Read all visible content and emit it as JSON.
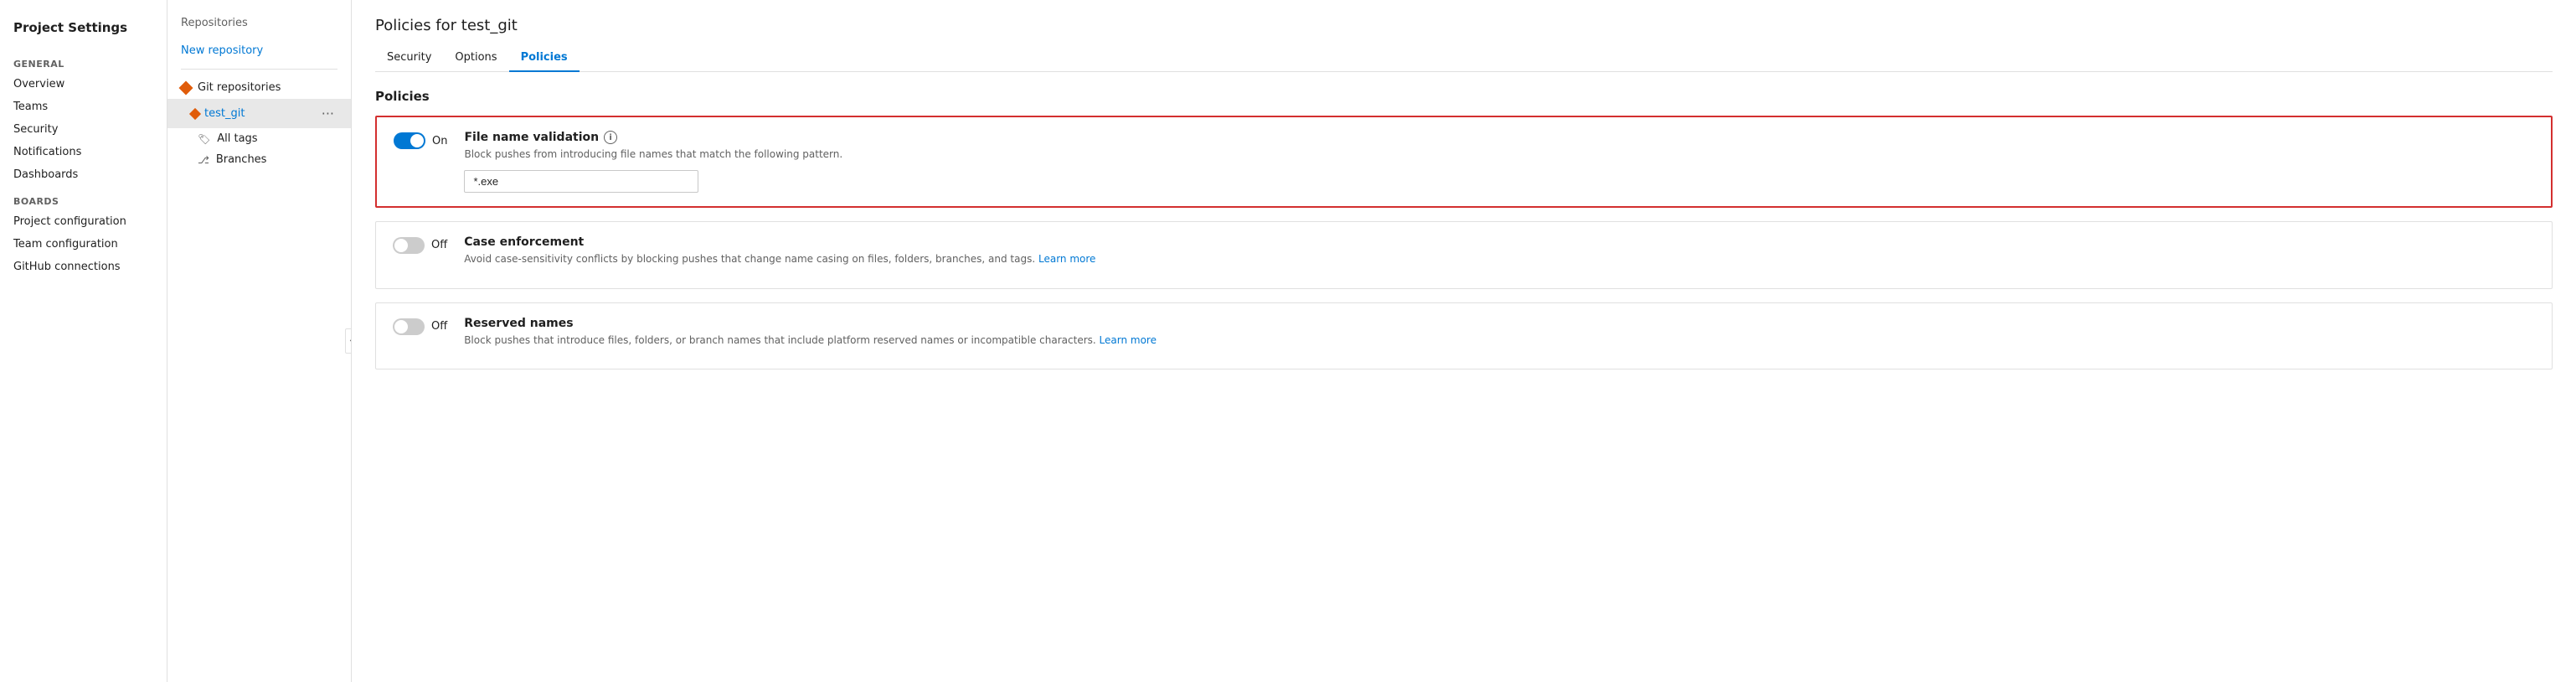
{
  "sidebar": {
    "title": "Project Settings",
    "general_label": "General",
    "items": [
      {
        "id": "overview",
        "label": "Overview"
      },
      {
        "id": "teams",
        "label": "Teams"
      },
      {
        "id": "security",
        "label": "Security"
      },
      {
        "id": "notifications",
        "label": "Notifications"
      },
      {
        "id": "dashboards",
        "label": "Dashboards"
      }
    ],
    "boards_label": "Boards",
    "boards_items": [
      {
        "id": "project-configuration",
        "label": "Project configuration"
      },
      {
        "id": "team-configuration",
        "label": "Team configuration"
      },
      {
        "id": "github-connections",
        "label": "GitHub connections"
      }
    ]
  },
  "middle": {
    "title": "Repositories",
    "new_repo_label": "New repository",
    "git_repos_label": "Git repositories",
    "repo_name": "test_git",
    "sub_items": [
      {
        "id": "all-tags",
        "label": "All tags"
      },
      {
        "id": "branches",
        "label": "Branches"
      }
    ]
  },
  "main": {
    "page_title": "Policies for test_git",
    "tabs": [
      {
        "id": "security",
        "label": "Security",
        "active": false
      },
      {
        "id": "options",
        "label": "Options",
        "active": false
      },
      {
        "id": "policies",
        "label": "Policies",
        "active": true
      }
    ],
    "policies_section_title": "Policies",
    "policies": [
      {
        "id": "file-name-validation",
        "name": "File name validation",
        "toggle_state": "On",
        "enabled": true,
        "description": "Block pushes from introducing file names that match the following pattern.",
        "input_value": "*.exe",
        "has_input": true,
        "highlighted": true
      },
      {
        "id": "case-enforcement",
        "name": "Case enforcement",
        "toggle_state": "Off",
        "enabled": false,
        "description": "Avoid case-sensitivity conflicts by blocking pushes that change name casing on files, folders, branches, and tags.",
        "learn_more_label": "Learn more",
        "has_input": false,
        "highlighted": false
      },
      {
        "id": "reserved-names",
        "name": "Reserved names",
        "toggle_state": "Off",
        "enabled": false,
        "description": "Block pushes that introduce files, folders, or branch names that include platform reserved names or incompatible characters.",
        "learn_more_label": "Learn more",
        "has_input": false,
        "highlighted": false
      }
    ]
  }
}
